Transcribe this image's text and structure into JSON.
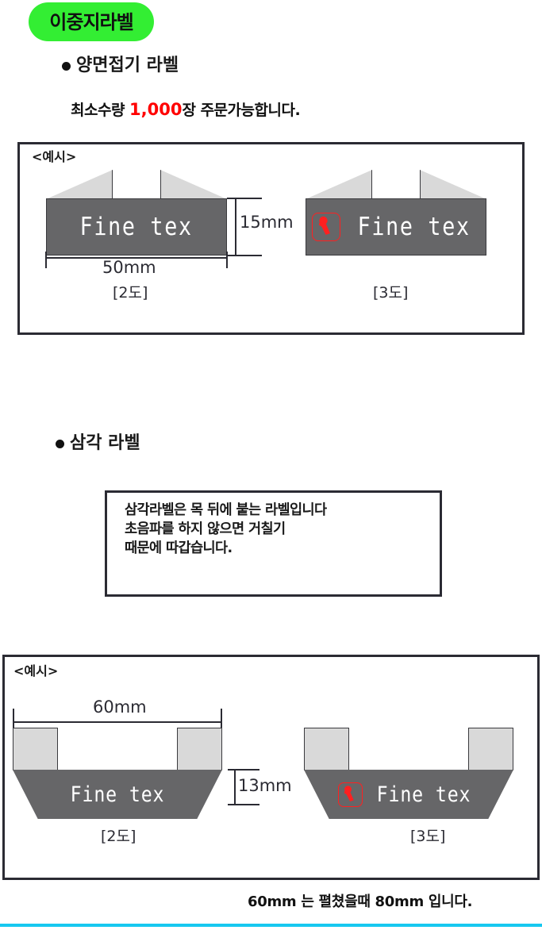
{
  "header": {
    "badge_label": "이중지라벨",
    "badge_color": "#33ee33"
  },
  "sections": [
    {
      "id": "double-fold",
      "heading": "양면접기 라벨",
      "min_quantity_prefix": "최소수량 ",
      "min_quantity_number": "1,000",
      "min_quantity_suffix": "장 주문가능합니다.",
      "min_quantity_number_color": "#ff0000",
      "example_tag": "<예시>",
      "samples": [
        {
          "caption": "[2도]",
          "brand_text": "Fine tex",
          "has_logo": false,
          "width_dim": "50mm",
          "height_dim": "15mm"
        },
        {
          "caption": "[3도]",
          "brand_text": "Fine tex",
          "has_logo": true,
          "logo_color": "#ff2020"
        }
      ]
    },
    {
      "id": "triangle",
      "heading": "삼각 라벨",
      "note_lines": [
        "삼각라벨은 목 뒤에 붙는 라벨입니다",
        "초음파를 하지 않으면 거칠기",
        "때문에 따갑습니다."
      ],
      "example_tag": "<예시>",
      "samples": [
        {
          "caption": "[2도]",
          "brand_text": "Fine tex",
          "has_logo": false,
          "width_dim": "60mm",
          "height_dim": "13mm"
        },
        {
          "caption": "[3도]",
          "brand_text": "Fine tex",
          "has_logo": true,
          "logo_color": "#ff2020"
        }
      ]
    }
  ],
  "footer": {
    "note": "60mm 는 펼쳤을때 80mm 입니다.",
    "rule_color": "#17c8f0"
  },
  "colors": {
    "label_body": "#666668",
    "label_flap": "#d9d9d9",
    "frame_border": "#2b2b33",
    "text": "#1a1a1a"
  }
}
